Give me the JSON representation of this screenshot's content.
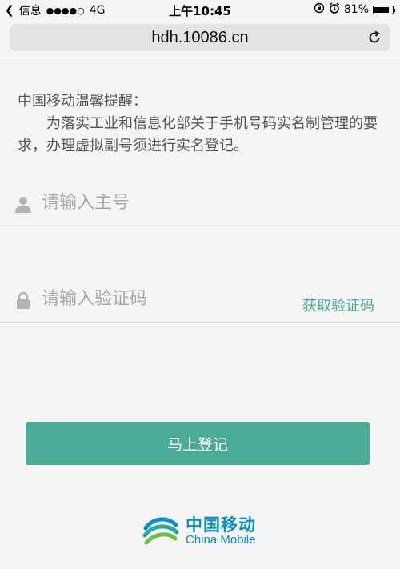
{
  "status_bar": {
    "back_app": "信息",
    "network": "4G",
    "time": "上午10:45",
    "battery_percent": "81%",
    "battery_level": 0.81
  },
  "browser": {
    "url": "hdh.10086.cn"
  },
  "notice": {
    "title": "中国移动温馨提醒：",
    "body": "为落实工业和信息化部关于手机号码实名制管理的要求，办理虚拟副号须进行实名登记。"
  },
  "form": {
    "phone_placeholder": "请输入主号",
    "code_placeholder": "请输入验证码",
    "get_code_label": "获取验证码",
    "submit_label": "马上登记"
  },
  "brand": {
    "name_cn": "中国移动",
    "name_en": "China Mobile"
  },
  "colors": {
    "accent": "#4aab97",
    "brand_blue": "#0b8ec8"
  }
}
